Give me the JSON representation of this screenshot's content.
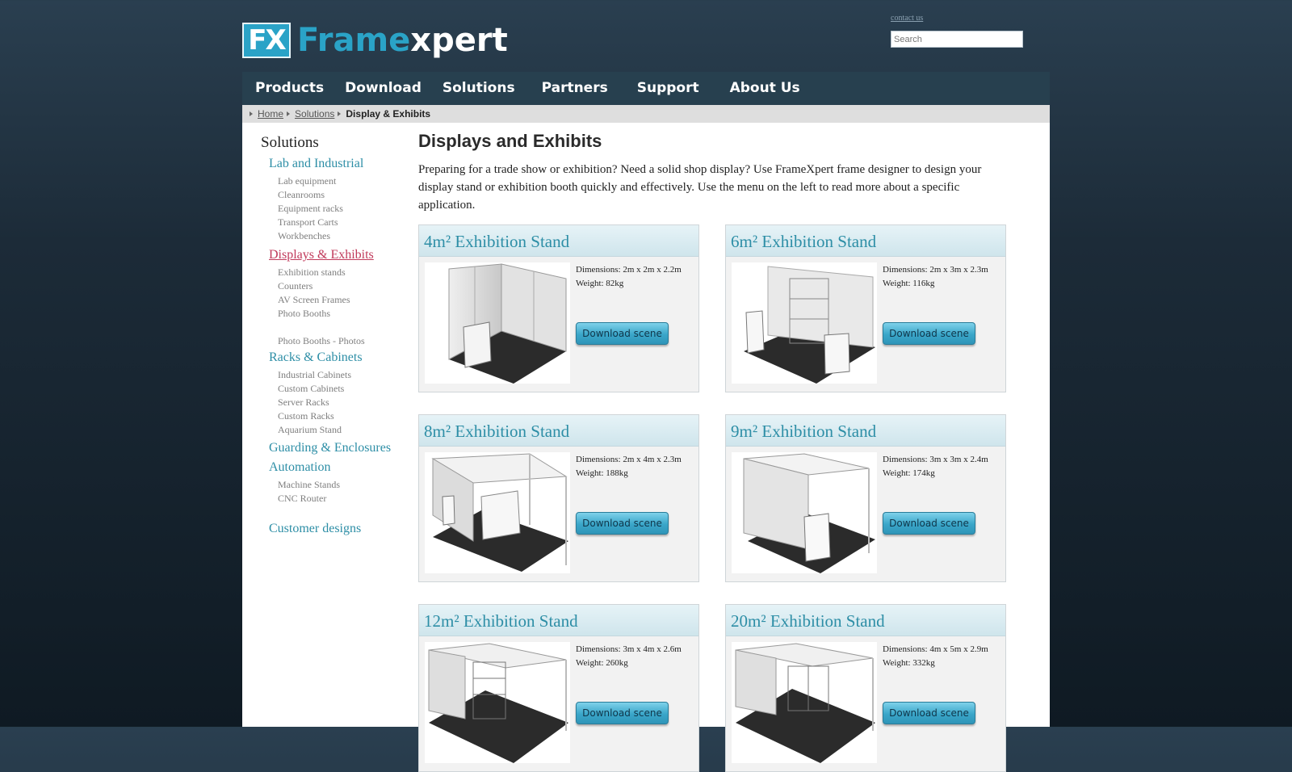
{
  "header": {
    "logo_mark": "FX",
    "logo_word_a": "Frame",
    "logo_word_b": "xpert",
    "contact_label": "contact us",
    "search_placeholder": "Search"
  },
  "nav": [
    "Products",
    "Download",
    "Solutions",
    "Partners",
    "Support",
    "About Us"
  ],
  "breadcrumb": {
    "home": "Home",
    "solutions": "Solutions",
    "current": "Display & Exhibits"
  },
  "sidebar": {
    "title": "Solutions",
    "groups": [
      {
        "label": "Lab and Industrial",
        "items": [
          "Lab equipment",
          "Cleanrooms",
          "Equipment racks",
          "Transport Carts",
          "Workbenches"
        ]
      },
      {
        "label": "Displays & Exhibits",
        "active": true,
        "items": [
          "Exhibition stands",
          "Counters",
          "AV Screen Frames",
          "Photo Booths",
          "Photo Booths - Photos"
        ]
      },
      {
        "label": "Racks & Cabinets",
        "items": [
          "Industrial Cabinets",
          "Custom Cabinets",
          "Server Racks",
          "Custom Racks",
          "Aquarium Stand"
        ]
      },
      {
        "label": "Guarding & Enclosures",
        "items": []
      },
      {
        "label": "Automation",
        "items": [
          "Machine Stands",
          "CNC Router"
        ]
      },
      {
        "label": "Customer designs",
        "items": []
      }
    ]
  },
  "main": {
    "title": "Displays and Exhibits",
    "intro": "Preparing for a trade show or exhibition? Need a solid shop display? Use FrameXpert frame designer to design your display stand or exhibition booth quickly and effectively. Use the menu on the left to read more about a specific application."
  },
  "download_label": "Download scene",
  "cards": [
    {
      "title": "4m² Exhibition Stand",
      "dimensions": "Dimensions: 2m x 2m x 2.2m",
      "weight": "Weight: 82kg"
    },
    {
      "title": "6m² Exhibition Stand",
      "dimensions": "Dimensions: 2m x 3m x 2.3m",
      "weight": "Weight: 116kg"
    },
    {
      "title": "8m² Exhibition Stand",
      "dimensions": "Dimensions: 2m x 4m x 2.3m",
      "weight": "Weight: 188kg"
    },
    {
      "title": "9m² Exhibition Stand",
      "dimensions": "Dimensions: 3m x 3m x 2.4m",
      "weight": "Weight: 174kg"
    },
    {
      "title": "12m² Exhibition Stand",
      "dimensions": "Dimensions: 3m x 4m x 2.6m",
      "weight": "Weight: 260kg"
    },
    {
      "title": "20m² Exhibition Stand",
      "dimensions": "Dimensions: 4m x 5m x 2.9m",
      "weight": "Weight: 332kg"
    }
  ],
  "colors": {
    "accent": "#2d8ea6",
    "active": "#c0395a",
    "nav_bg": "#27404f"
  }
}
